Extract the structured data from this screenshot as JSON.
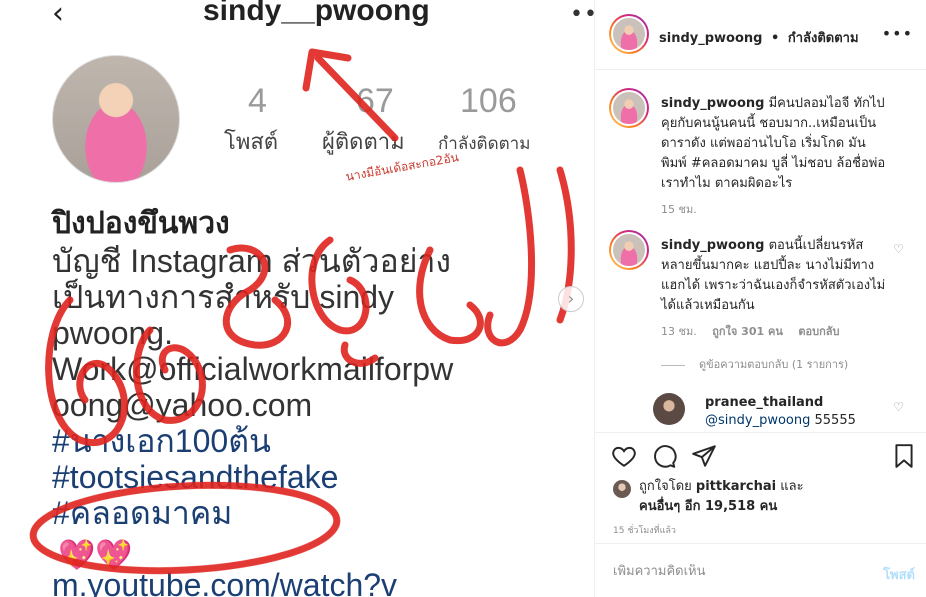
{
  "screenshot": {
    "handle": "sindy__pwoong",
    "stats": [
      {
        "num": "4",
        "label": "โพสต์"
      },
      {
        "num": "67",
        "label": "ผู้ติดตาม"
      },
      {
        "num": "106",
        "label": "กำลังติดตาม"
      }
    ],
    "display_name": "ปิงปองขึนพวง",
    "bio_lines": [
      "บัญชี Instagram ส่วนตัวอย่าง",
      "เป็นทางการสำหรับ sindy",
      "pwoong.",
      "Work@officialworkmailforpw",
      "oong@yahoo.com"
    ],
    "hashtags": [
      "#นางเอก100ต้น",
      "#tootsiesandthefake",
      "#คลอดมาคม"
    ],
    "partial_line": "m.youtube.com/watch?v",
    "annotation": "นางมีอันเด้อสะกอ2อัน",
    "hearts": "💖💖"
  },
  "header": {
    "username": "sindy_pwoong",
    "separator": "•",
    "follow_status": "กำลังติดตาม"
  },
  "comments": [
    {
      "username": "sindy_pwoong",
      "text": "มีคนปลอมไอจี ทักไปคุยกับคนนู้นคนนี้ ชอบมาก..เหมือนเป็นดาราดัง แต่พออ่านไบโอ เริ่มโกด มันพิมพ์ #คลอดมาคม บูลี่ ไม่ชอบ ล้อชื่อพ่อเราทำไม ตาคมผิดอะไร",
      "time": "15 ชม."
    },
    {
      "username": "sindy_pwoong",
      "text": "ตอนนี้เปลี่ยนรหัสหลายขึ้นมากคะ แฮปปี้ละ นางไม่มีทางแฮกได้ เพราะว่าฉันเองก็จำรหัสตัวเองไม่ได้แล้วเหมือนกัน",
      "time": "13 ชม.",
      "likes": "ถูกใจ 301 คน",
      "reply": "ตอบกลับ",
      "view_replies": "ดูข้อความตอบกลับ (1 รายการ)"
    }
  ],
  "reply": {
    "username": "pranee_thailand",
    "mention": "@sindy_pwoong",
    "text": "55555"
  },
  "likes": {
    "prefix": "ถูกใจโดย",
    "user": "pittkarchai",
    "middle": "และ",
    "others": "คนอื่นๆ อีก 19,518 คน"
  },
  "post_time": "15 ชั่วโมงที่แล้ว",
  "add_comment": {
    "placeholder": "เพิ่มความคิดเห็น",
    "post_label": "โพสต์"
  },
  "colors": {
    "scribble_red": "#e0231f",
    "link_blue": "#00376b",
    "post_disabled": "#b2dffc"
  }
}
